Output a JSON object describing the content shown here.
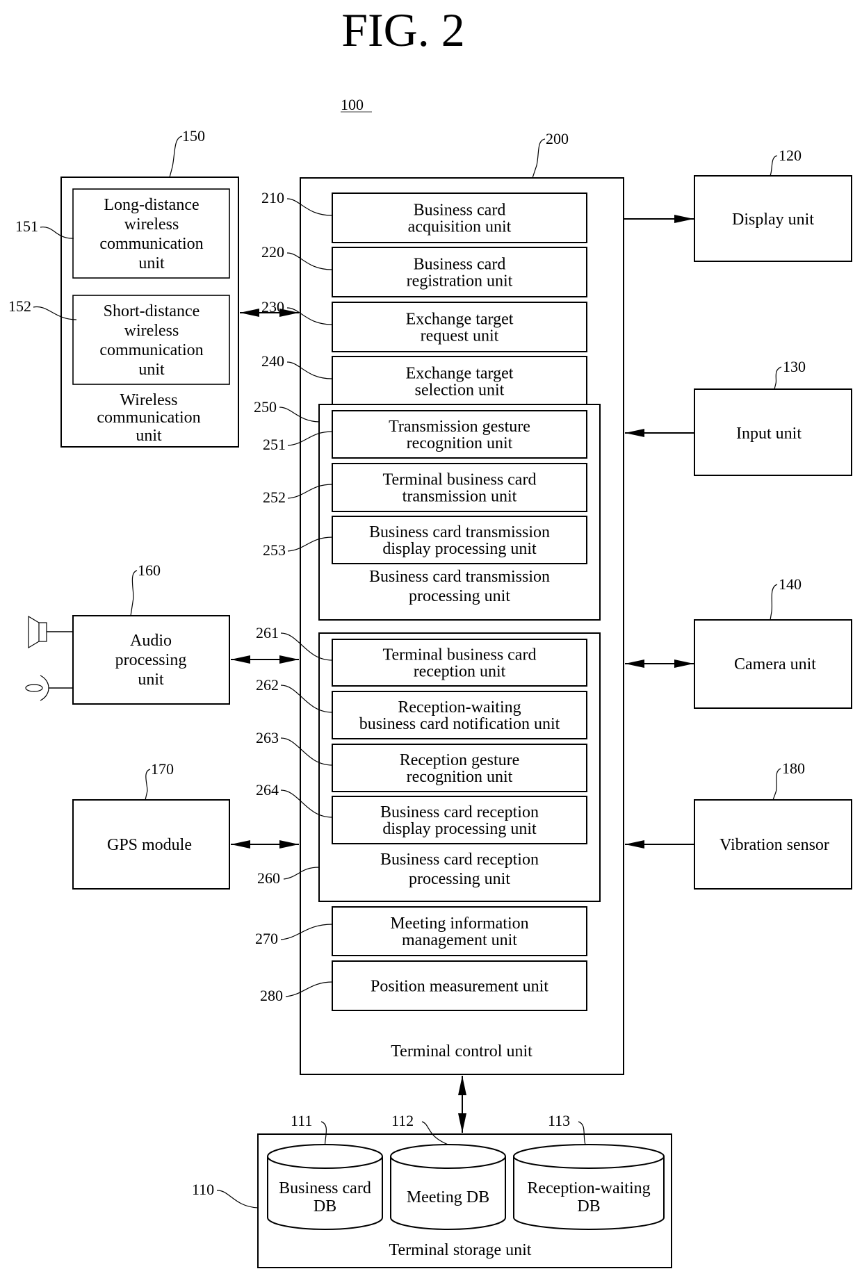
{
  "figure": {
    "title": "FIG. 2",
    "system_ref": "100"
  },
  "wireless": {
    "ref": "150",
    "label": [
      "Wireless",
      "communication",
      "unit"
    ],
    "long": {
      "ref": "151",
      "label": [
        "Long-distance",
        "wireless",
        "communication",
        "unit"
      ]
    },
    "short": {
      "ref": "152",
      "label": [
        "Short-distance",
        "wireless",
        "communication",
        "unit"
      ]
    }
  },
  "audio": {
    "ref": "160",
    "label": [
      "Audio",
      "processing",
      "unit"
    ],
    "speaker_icon": "speaker-icon",
    "mic_icon": "microphone-icon"
  },
  "gps": {
    "ref": "170",
    "label": [
      "GPS module"
    ]
  },
  "display": {
    "ref": "120",
    "label": [
      "Display unit"
    ]
  },
  "input": {
    "ref": "130",
    "label": [
      "Input unit"
    ]
  },
  "camera": {
    "ref": "140",
    "label": [
      "Camera unit"
    ]
  },
  "vibration": {
    "ref": "180",
    "label": [
      "Vibration sensor"
    ]
  },
  "control": {
    "ref": "200",
    "label": "Terminal control unit",
    "units": [
      {
        "ref": "210",
        "label": [
          "Business card",
          "acquisition unit"
        ]
      },
      {
        "ref": "220",
        "label": [
          "Business card",
          "registration unit"
        ]
      },
      {
        "ref": "230",
        "label": [
          "Exchange target",
          "request unit"
        ]
      },
      {
        "ref": "240",
        "label": [
          "Exchange target",
          "selection unit"
        ]
      }
    ],
    "transmission": {
      "ref": "250",
      "label": [
        "Business card transmission",
        "processing unit"
      ],
      "units": [
        {
          "ref": "251",
          "label": [
            "Transmission gesture",
            "recognition unit"
          ]
        },
        {
          "ref": "252",
          "label": [
            "Terminal business card",
            "transmission unit"
          ]
        },
        {
          "ref": "253",
          "label": [
            "Business card transmission",
            "display processing unit"
          ]
        }
      ]
    },
    "reception": {
      "ref": "260",
      "label": [
        "Business card reception",
        "processing unit"
      ],
      "units": [
        {
          "ref": "261",
          "label": [
            "Terminal business card",
            "reception unit"
          ]
        },
        {
          "ref": "262",
          "label": [
            "Reception-waiting",
            "business card notification unit"
          ]
        },
        {
          "ref": "263",
          "label": [
            "Reception gesture",
            "recognition unit"
          ]
        },
        {
          "ref": "264",
          "label": [
            "Business card reception",
            "display processing unit"
          ]
        }
      ]
    },
    "meeting": {
      "ref": "270",
      "label": [
        "Meeting information",
        "management unit"
      ]
    },
    "position": {
      "ref": "280",
      "label": [
        "Position measurement unit"
      ]
    }
  },
  "storage": {
    "ref": "110",
    "label": "Terminal storage unit",
    "dbs": [
      {
        "ref": "111",
        "label": [
          "Business card",
          "DB"
        ]
      },
      {
        "ref": "112",
        "label": [
          "Meeting DB"
        ]
      },
      {
        "ref": "113",
        "label": [
          "Reception-waiting",
          "DB"
        ]
      }
    ]
  }
}
